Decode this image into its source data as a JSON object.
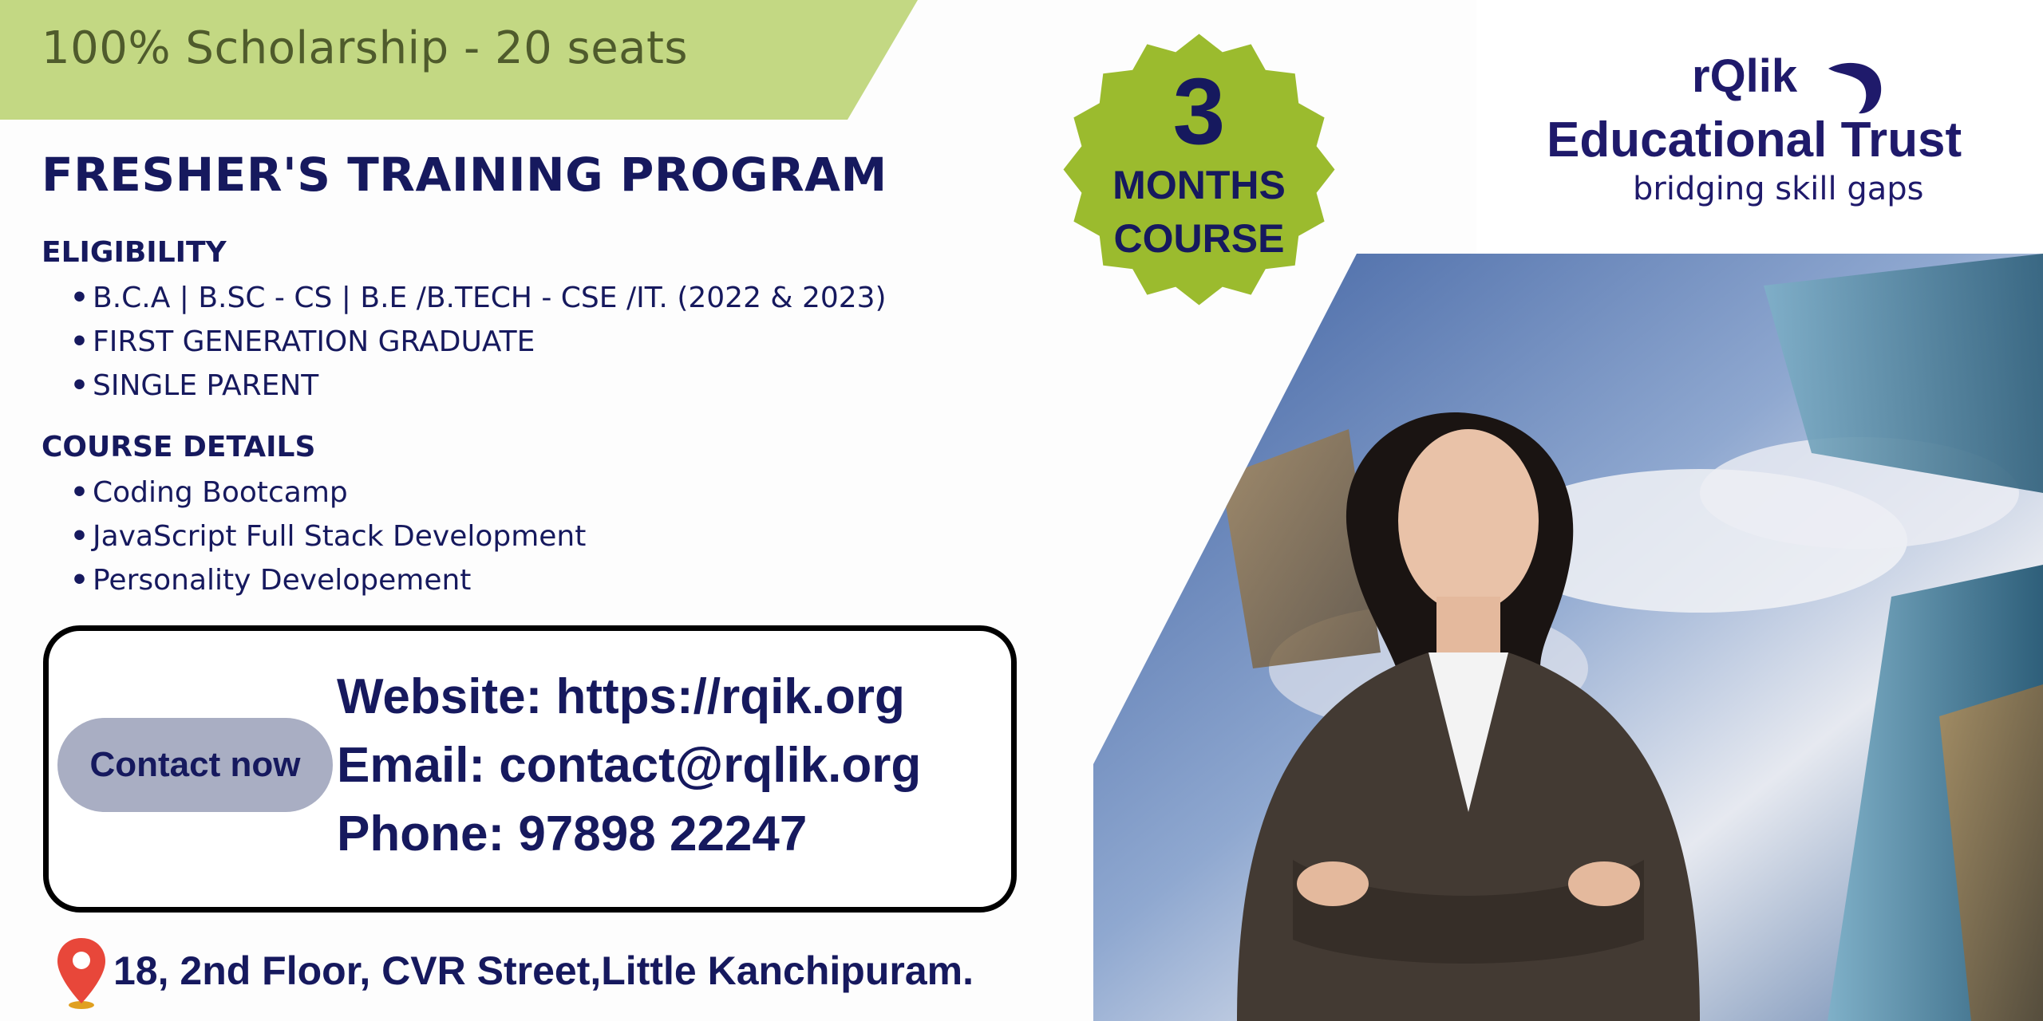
{
  "banner": {
    "text": "100% Scholarship - 20 seats",
    "color": "#c3d883"
  },
  "program_title": "FRESHER'S TRAINING PROGRAM",
  "eligibility": {
    "heading": "ELIGIBILITY",
    "items": [
      "B.C.A | B.SC - CS | B.E /B.TECH - CSE /IT. (2022 & 2023)",
      "FIRST GENERATION GRADUATE",
      "SINGLE PARENT"
    ]
  },
  "course_details": {
    "heading": "COURSE DETAILS",
    "items": [
      "Coding Bootcamp",
      "JavaScript Full Stack Development",
      "Personality Developement"
    ]
  },
  "contact": {
    "button_label": "Contact now",
    "website": "Website: https://rqik.org",
    "email": "Email: contact@rqlik.org",
    "phone": "Phone: 97898 22247"
  },
  "address": "18, 2nd Floor, CVR Street,Little Kanchipuram.",
  "badge": {
    "number": "3",
    "line1": "MONTHS",
    "line2": "COURSE",
    "color": "#9bbb2e"
  },
  "logo": {
    "brand": "rQlik",
    "name": "Educational Trust",
    "tagline": "bridging skill gaps",
    "color": "#1f1a6b"
  },
  "icons": {
    "address": "location-pin-icon"
  }
}
